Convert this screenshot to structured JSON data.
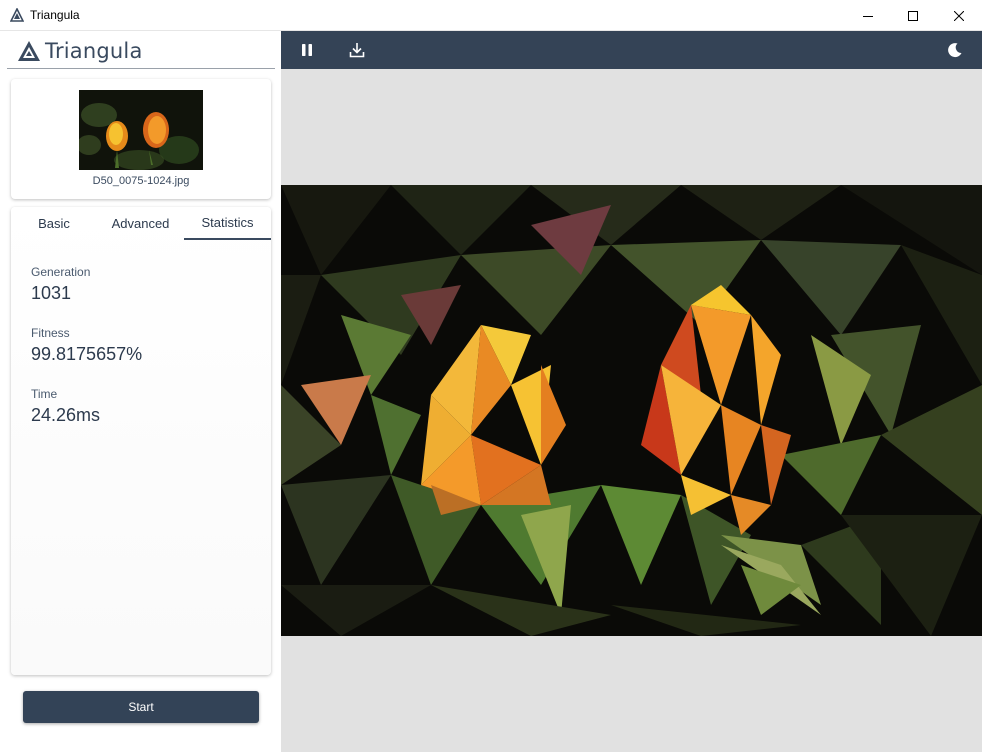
{
  "window": {
    "title": "Triangula",
    "icons": {
      "app": "triangula-logo-icon",
      "minimize": "minimize-icon",
      "maximize": "maximize-icon",
      "close": "close-icon"
    }
  },
  "brand": {
    "name": "Triangula",
    "icon": "triangula-logo-icon"
  },
  "image": {
    "filename": "D50_0075-1024.jpg"
  },
  "tabs": [
    {
      "label": "Basic",
      "active": false
    },
    {
      "label": "Advanced",
      "active": false
    },
    {
      "label": "Statistics",
      "active": true
    }
  ],
  "stats": {
    "generation_label": "Generation",
    "generation_value": "1031",
    "fitness_label": "Fitness",
    "fitness_value": "99.8175657%",
    "time_label": "Time",
    "time_value": "24.26ms"
  },
  "actions": {
    "start_label": "Start"
  },
  "toolbar": {
    "icons": [
      "pause-icon",
      "download-icon",
      "moon-icon"
    ]
  },
  "colors": {
    "accent": "#334357",
    "toolbar": "#344356",
    "canvas_bg": "#e1e1e1",
    "text": "#2c3a4d"
  }
}
